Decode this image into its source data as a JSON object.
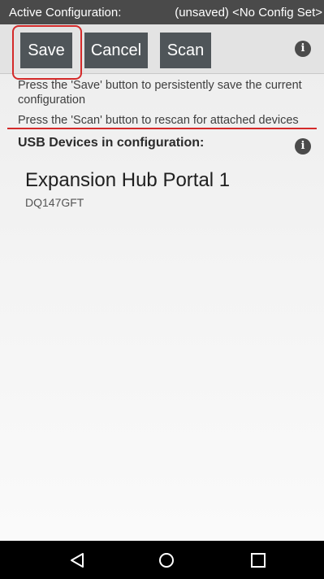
{
  "status_bar": {
    "title": "Active Configuration:",
    "config_status": "(unsaved) <No Config Set>"
  },
  "toolbar": {
    "save_label": "Save",
    "cancel_label": "Cancel",
    "scan_label": "Scan",
    "info_icon_glyph": "i"
  },
  "help": {
    "save_text": "Press the 'Save' button to persistently save the current configuration",
    "scan_text": "Press the 'Scan' button to rescan for attached devices"
  },
  "usb_section": {
    "title": "USB Devices in configuration:",
    "info_icon_glyph": "i",
    "devices": [
      {
        "name": "Expansion Hub Portal 1",
        "serial": "DQ147GFT"
      }
    ]
  },
  "nav_bar": {
    "icons": [
      "back-icon",
      "home-icon",
      "recent-apps-icon"
    ]
  },
  "colors": {
    "highlight": "#d42a2a",
    "button_bg": "#4f5559",
    "status_bar_bg": "#4a4a4a",
    "nav_bar_bg": "#000000"
  }
}
